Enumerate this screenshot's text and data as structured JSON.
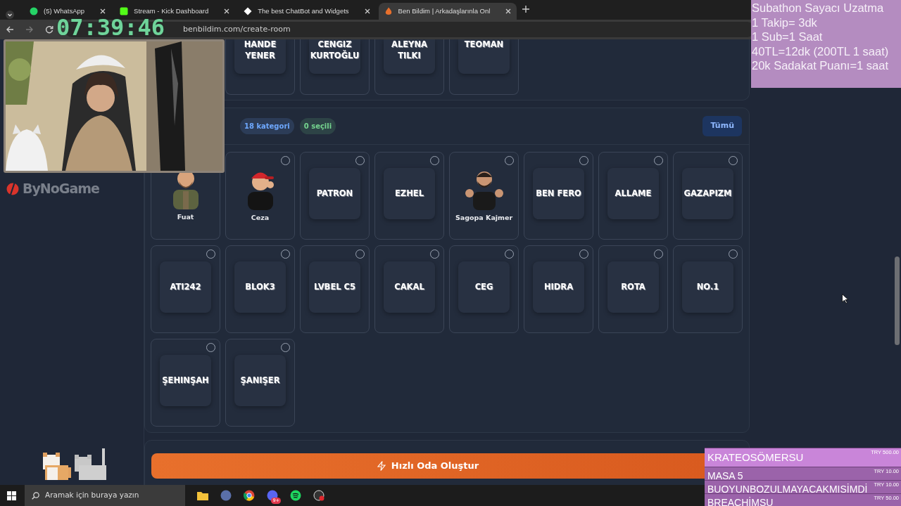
{
  "browser": {
    "tabs": [
      {
        "label": "(5) WhatsApp",
        "selected": false
      },
      {
        "label": "Stream - Kick Dashboard",
        "selected": false
      },
      {
        "label": "The best ChatBot and Widgets",
        "selected": false
      },
      {
        "label": "Ben Bildim | Arkadaşlarınla Onl",
        "selected": true
      }
    ],
    "url": "benbildim.com/create-room"
  },
  "clock": "07:39:46",
  "logo": "ByNoGame",
  "top_cards": [
    {
      "name": "HANDE YENER"
    },
    {
      "name": "CENGIZ KURTOĞLU"
    },
    {
      "name": "ALEYNA TILKI"
    },
    {
      "name": "TEOMAN"
    }
  ],
  "categories": {
    "badges": [
      {
        "label": "18 kategori",
        "color": "#6ea8fe"
      },
      {
        "label": "0 seçili",
        "color": "#75d48f"
      }
    ],
    "all_button": "Tümü",
    "cards": [
      {
        "name": "Fuat"
      },
      {
        "name": "Ceza",
        "selected": false
      },
      {
        "kind": "text",
        "name": "PATRON",
        "selected": false
      },
      {
        "kind": "text",
        "name": "EZHEL",
        "selected": false
      },
      {
        "name": "Sagopa Kajmer",
        "selected": false
      },
      {
        "kind": "text",
        "name": "BEN FERO",
        "selected": false
      },
      {
        "kind": "text",
        "name": "ALLAME",
        "selected": false
      },
      {
        "kind": "text",
        "name": "GAZAPIZM",
        "selected": false
      },
      {
        "kind": "text",
        "name": "ATI242",
        "selected": false
      },
      {
        "kind": "text",
        "name": "BLOK3",
        "selected": false
      },
      {
        "kind": "text",
        "name": "LVBEL C5",
        "selected": false
      },
      {
        "kind": "text",
        "name": "CAKAL",
        "selected": false
      },
      {
        "kind": "text",
        "name": "CEG",
        "selected": false
      },
      {
        "kind": "text",
        "name": "HIDRA",
        "selected": false
      },
      {
        "kind": "text",
        "name": "ROTA",
        "selected": false
      },
      {
        "kind": "text",
        "name": "NO.1",
        "selected": false
      },
      {
        "kind": "text",
        "name": "ŞEHINŞAH",
        "selected": false
      },
      {
        "kind": "text",
        "name": "ŞANIŞER",
        "selected": false
      }
    ]
  },
  "create_button": "Hızlı Oda Oluştur",
  "subathon": [
    "Subathon Sayacı Uzatma",
    "1 Takip= 3dk",
    "1 Sub=1 Saat",
    "40TL=12dk (200TL 1 saat)",
    "20k Sadakat Puanı=1 saat"
  ],
  "donations": [
    {
      "name": "KRATEOSÖMERSU",
      "amount": "TRY 500.00",
      "highlighted": true
    },
    {
      "name": "MASA 5",
      "amount": "TRY 10.00",
      "highlighted": false
    },
    {
      "name": "BUOYUNBOZULMAYACAKMISİMDİ",
      "amount": "TRY 10.00",
      "highlighted": false
    },
    {
      "name": "BREACHİMSU",
      "amount": "TRY 50.00",
      "highlighted": false
    }
  ],
  "taskbar": {
    "search_placeholder": "Aramak için buraya yazın",
    "notification_badge": "9+"
  }
}
